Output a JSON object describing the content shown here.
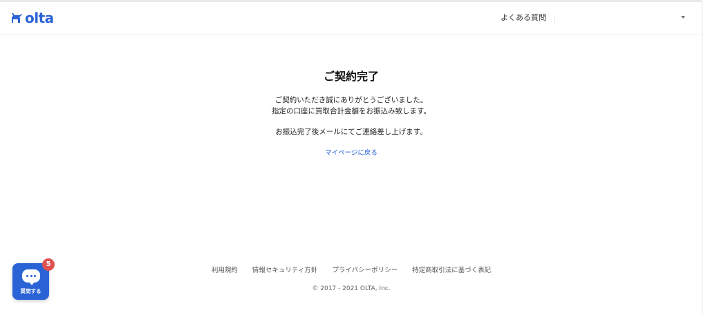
{
  "header": {
    "logo_text": "olta",
    "faq_label": "よくある質問"
  },
  "main": {
    "title": "ご契約完了",
    "message_line1": "ご契約いただき誠にありがとうございました。",
    "message_line2": "指定の口座に買取合計金額をお振込み致します。",
    "message_line3": "お振込完了後メールにてご連絡差し上げます。",
    "mypage_link": "マイページに戻る"
  },
  "footer": {
    "links": [
      "利用規約",
      "情報セキュリティ方針",
      "プライバシーポリシー",
      "特定商取引法に基づく表記"
    ],
    "copyright": "© 2017 - 2021 OLTA, Inc."
  },
  "chat": {
    "label": "質問する",
    "badge_count": "5"
  },
  "colors": {
    "brand": "#2a63d6",
    "badge": "#e05252"
  },
  "icons": {
    "logo": "cat-icon",
    "dropdown": "chevron-down-icon",
    "chat": "chat-bubble-icon"
  }
}
